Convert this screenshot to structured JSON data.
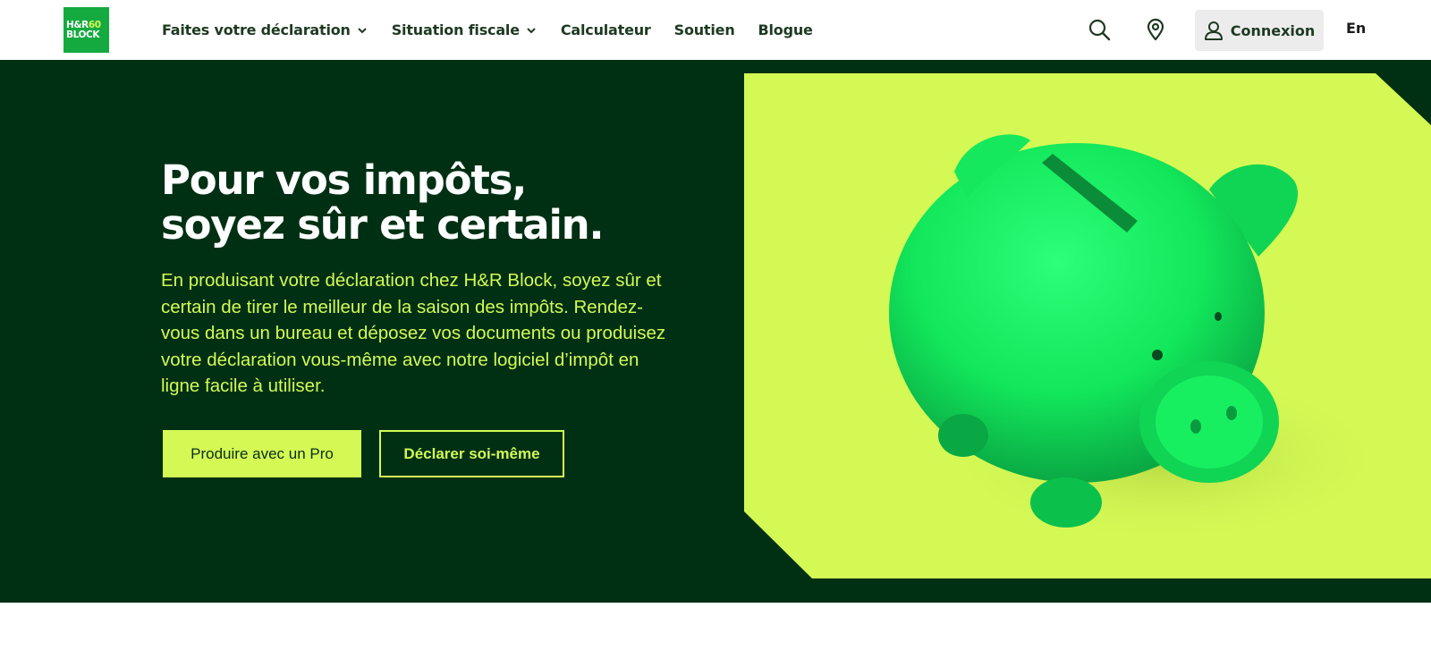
{
  "brand": {
    "logo_line1": "H&R",
    "logo_line1_accent": "60",
    "logo_line2": "BLOCK",
    "colors": {
      "brand_green": "#14aa40",
      "hero_bg": "#003014",
      "accent_lime": "#d4f955",
      "piggy_green": "#12e65a"
    }
  },
  "nav": {
    "items": [
      {
        "label": "Faites votre déclaration",
        "has_dropdown": true
      },
      {
        "label": "Situation fiscale",
        "has_dropdown": true
      },
      {
        "label": "Calculateur",
        "has_dropdown": false
      },
      {
        "label": "Soutien",
        "has_dropdown": false
      },
      {
        "label": "Blogue",
        "has_dropdown": false
      }
    ]
  },
  "header": {
    "icons": [
      "search-icon",
      "location-pin-icon",
      "user-icon"
    ],
    "login_label": "Connexion",
    "language_label": "En"
  },
  "hero": {
    "title_line1": "Pour vos impôts,",
    "title_line2": "soyez sûr et certain.",
    "description": "En produisant votre déclaration chez H&R Block, soyez sûr et certain de tirer le meilleur de la saison des impôts. Rendez-vous dans un bureau et déposez vos documents ou produisez votre déclaration vous-même avec notre logiciel d’impôt en ligne facile à utiliser.",
    "primary_button": "Produire avec un Pro",
    "secondary_button": "Déclarer soi-même",
    "image": "green-piggy-bank"
  }
}
